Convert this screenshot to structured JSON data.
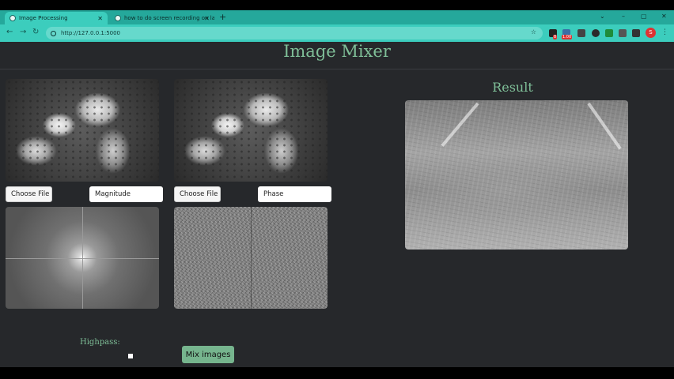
{
  "browser": {
    "tabs": [
      {
        "title": "Image Processing",
        "active": true
      },
      {
        "title": "how to do screen recording on la",
        "active": false
      }
    ],
    "new_tab": "+",
    "window_controls": [
      "⌄",
      "–",
      "▢",
      "✕"
    ],
    "url": "http://127.0.0.1:5000",
    "profile_initial": "S",
    "extension_badges": [
      "8",
      "1.00"
    ]
  },
  "page": {
    "title": "Image Mixer",
    "result_title": "Result",
    "panel1": {
      "file_button": "Choose File",
      "component": "Magnitude"
    },
    "panel2": {
      "file_button": "Choose File",
      "component": "Phase"
    },
    "highpass_label": "Highpass:",
    "mix_button": "Mix images"
  },
  "colors": {
    "accent": "#7fbf98",
    "page_bg": "#26282b",
    "tab_bar": "#25a89b",
    "button_bg": "#76b58e"
  }
}
